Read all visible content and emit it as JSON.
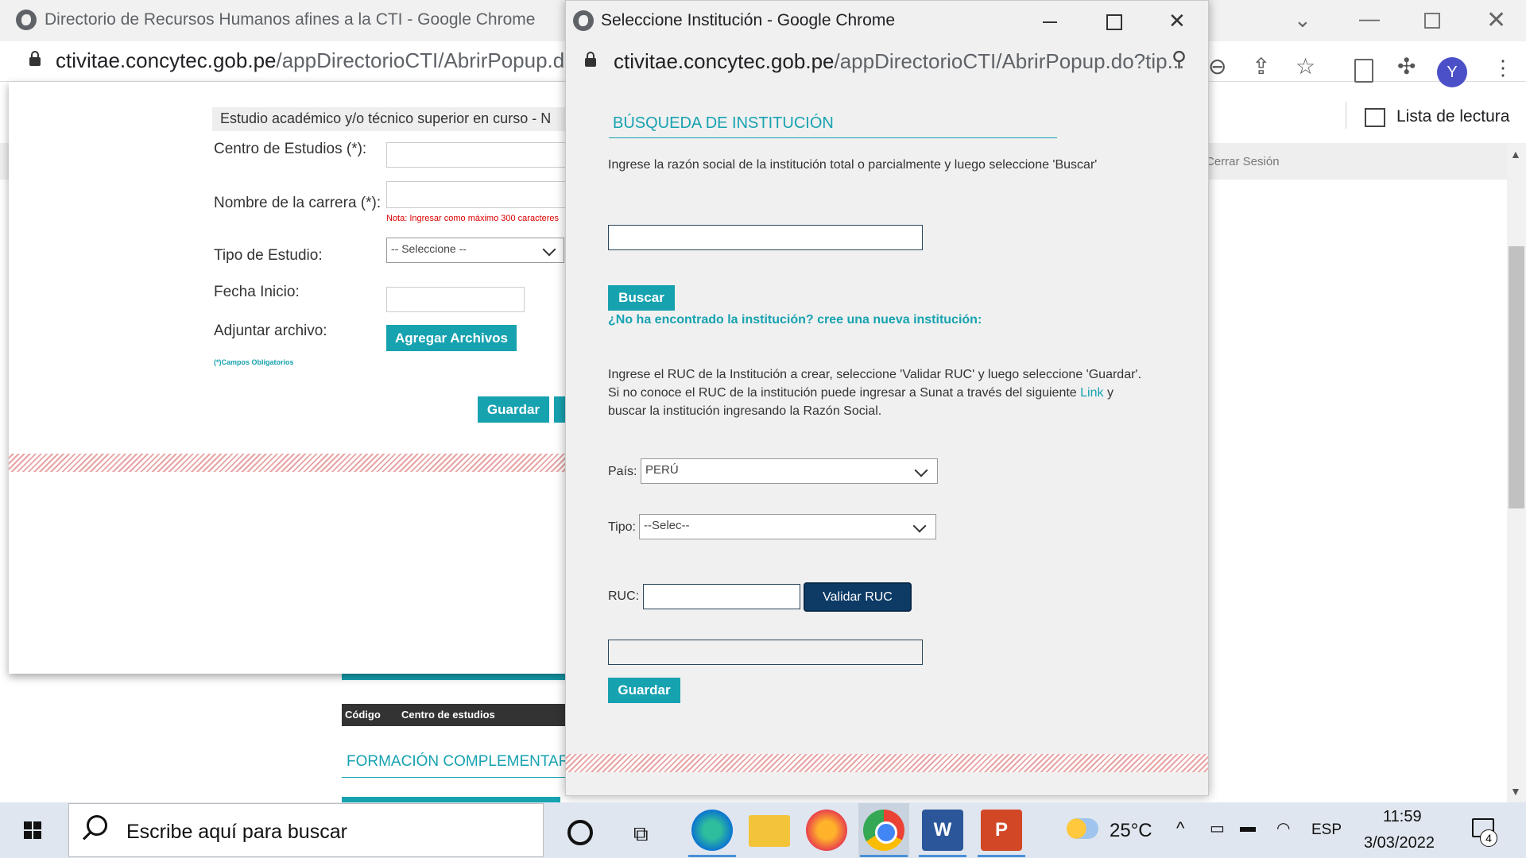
{
  "bg_window": {
    "title": "Directorio de Recursos Humanos afines a la CTI - Google Chrome",
    "url_host": "ctivitae.concytec.gob.pe",
    "url_path": "/appDirectorioCTI/AbrirPopup.do?ti",
    "reading_list": "Lista de lectura",
    "logout": "Cerrar Sesión",
    "avatar_letter": "Y"
  },
  "bg_form": {
    "section_header": "Estudio académico y/o técnico superior en curso - N",
    "centro_label": "Centro de Estudios (*):",
    "carrera_label": "Nombre de la carrera (*):",
    "carrera_note": "Nota: Ingresar como máximo 300 caracteres",
    "tipo_label": "Tipo de Estudio:",
    "tipo_value": "-- Seleccione --",
    "fecha_label": "Fecha Inicio:",
    "adjuntar_label": "Adjuntar archivo:",
    "agregar_button": "Agregar Archivos",
    "required_note": "(*)Campos Obligatorios",
    "guardar_button": "Guardar",
    "table_col_codigo": "Código",
    "table_col_centro": "Centro de estudios",
    "formacion_header": "FORMACIÓN COMPLEMENTARIA"
  },
  "popup": {
    "title": "Seleccione Institución - Google Chrome",
    "url_host": "ctivitae.concytec.gob.pe",
    "url_path": "/appDirectorioCTI/AbrirPopup.do?tip...",
    "heading": "BÚSQUEDA DE INSTITUCIÓN",
    "instructions": "Ingrese la razón social de la institución total o parcialmente y luego seleccione 'Buscar'",
    "search_value": "",
    "buscar_button": "Buscar",
    "not_found": "¿No ha encontrado la institución? cree una nueva institución:",
    "ruc_line1": "Ingrese el RUC de la Institución a crear, seleccione 'Validar RUC' y luego seleccione 'Guardar'.",
    "ruc_line2_pre": "Si no conoce el RUC de la institución puede ingresar a Sunat a través del siguiente",
    "ruc_link": "Link",
    "ruc_line2_post": "y",
    "ruc_line3": "buscar la institución ingresando la Razón Social.",
    "pais_label": "País:",
    "pais_value": "PERÚ",
    "tipo_label": "Tipo:",
    "tipo_value": "--Selec--",
    "ruc_label": "RUC:",
    "ruc_value": "",
    "validar_button": "Validar RUC",
    "result_value": "",
    "guardar_button": "Guardar"
  },
  "taskbar": {
    "search_placeholder": "Escribe aquí para buscar",
    "temperature": "25°C",
    "language": "ESP",
    "time": "11:59",
    "date": "3/03/2022",
    "notifications": "4"
  },
  "colors": {
    "teal": "#17a2b0",
    "navy_button": "#0d3b66",
    "hatch": "#e8a3a3"
  }
}
